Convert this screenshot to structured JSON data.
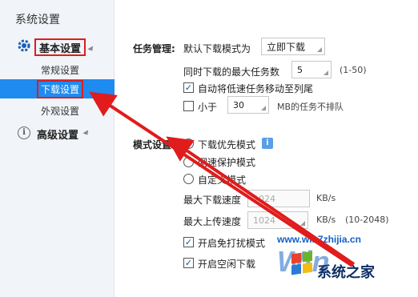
{
  "sidebar": {
    "title": "系统设置",
    "basic": "基本设置",
    "items": [
      {
        "label": "常规设置"
      },
      {
        "label": "下载设置"
      },
      {
        "label": "外观设置"
      }
    ],
    "advanced": "高级设置"
  },
  "task": {
    "section_label": "任务管理:",
    "default_mode_label": "默认下载模式为",
    "default_mode_value": "立即下载",
    "max_tasks_label": "同时下载的最大任务数",
    "max_tasks_value": "5",
    "max_tasks_range": "(1-50)",
    "auto_move_label": "自动将低速任务移动至列尾",
    "smaller_label": "小于",
    "smaller_value": "30",
    "smaller_suffix": "MB的任务不排队"
  },
  "mode": {
    "section_label": "模式设置:",
    "opt1": "下载优先模式",
    "opt2": "网速保护模式",
    "opt3": "自定义模式",
    "max_down_label": "最大下载速度",
    "max_down_value": "1024",
    "unit1": "KB/s",
    "max_up_label": "最大上传速度",
    "max_up_value": "1024",
    "unit2": "KB/s",
    "up_range": "(10-2048)",
    "free_label": "开启免打扰模式",
    "idle_label": "开启空闲下载"
  },
  "watermark": {
    "url": "www.win7zhijia.cn",
    "name": "系统之家",
    "big": "Win"
  },
  "colors": {
    "accent_blue": "#1f8bf0",
    "highlight_red": "#e01c1c"
  }
}
